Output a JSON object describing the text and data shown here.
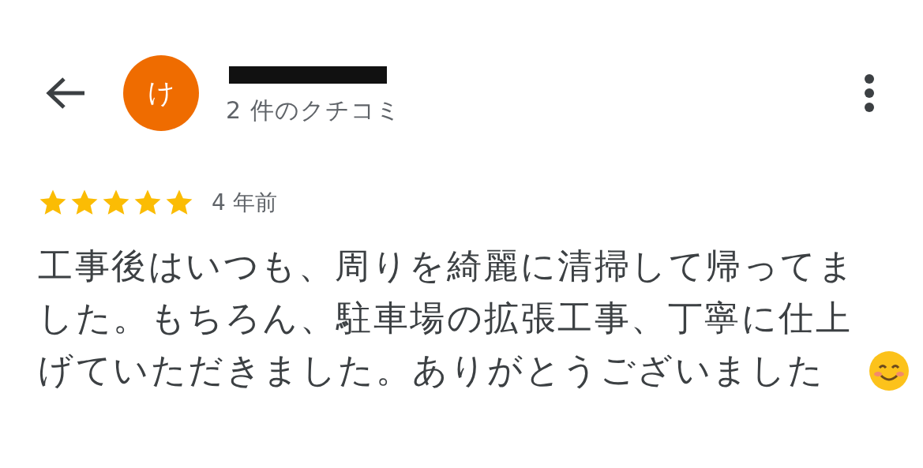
{
  "header": {
    "avatar": {
      "letter": "け",
      "color": "#ef6c00"
    },
    "review_count": "2 件のクチコミ"
  },
  "review": {
    "stars": 5,
    "time": "4 年前",
    "text": "工事後はいつも、周りを綺麗に清掃して帰ってました。もちろん、駐車場の拡張工事、丁寧に仕上げていただきました。ありがとうございました"
  }
}
